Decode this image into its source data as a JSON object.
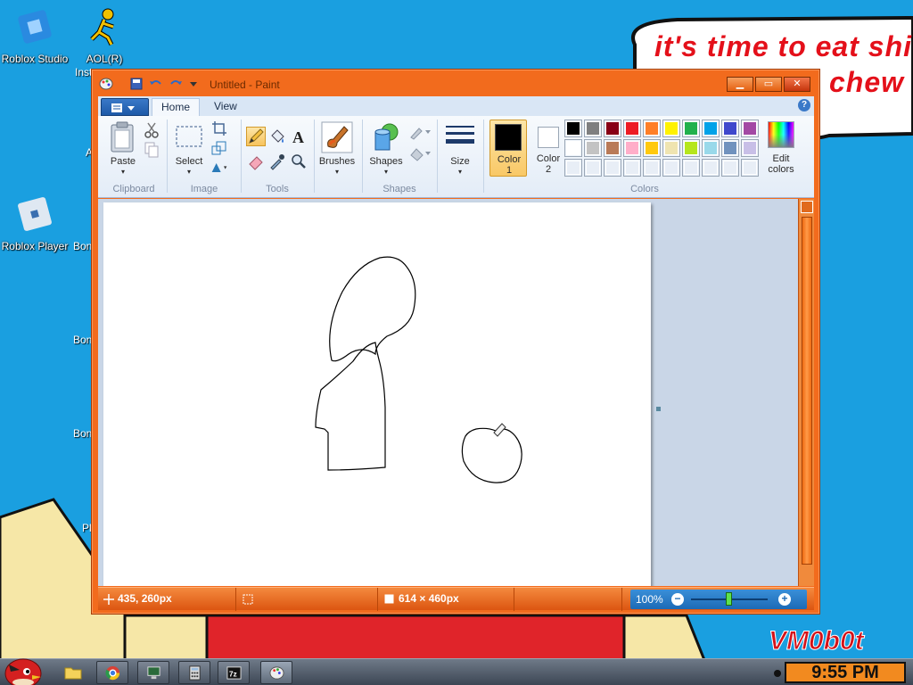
{
  "desktop": {
    "icons": [
      {
        "label": "Roblox Studio"
      },
      {
        "label": "AOL(R)"
      },
      {
        "label": "Inst"
      },
      {
        "label": "Roblox Player"
      }
    ],
    "cut_labels": [
      "A",
      "Bon",
      "Bon",
      "Bon",
      "Pl"
    ],
    "speech_line1": "it's time to eat shit",
    "speech_line2": "chew",
    "watermark": "VM0b0t"
  },
  "window": {
    "title": "Untitled - Paint",
    "buttons": {
      "minimize": "▁",
      "maximize": "▭",
      "close": "✕"
    }
  },
  "ribbon": {
    "tabs": [
      {
        "label": "Home"
      },
      {
        "label": "View"
      }
    ],
    "help": "?",
    "groups": {
      "clipboard": "Clipboard",
      "image": "Image",
      "tools": "Tools",
      "shapes": "Shapes",
      "colors": "Colors"
    },
    "buttons": {
      "paste": "Paste",
      "select": "Select",
      "brushes": "Brushes",
      "shapes": "Shapes",
      "size": "Size",
      "color1_line1": "Color",
      "color1_line2": "1",
      "color2_line1": "Color",
      "color2_line2": "2",
      "edit_colors_line1": "Edit",
      "edit_colors_line2": "colors"
    },
    "color1": "#000000",
    "color2": "#ffffff",
    "palette_row1": [
      "#000000",
      "#7f7f7f",
      "#880015",
      "#ed1c24",
      "#ff7f27",
      "#fff200",
      "#22b14c",
      "#00a2e8",
      "#3f48cc",
      "#a349a4"
    ],
    "palette_row2": [
      "#ffffff",
      "#c3c3c3",
      "#b97a57",
      "#ffaec9",
      "#ffc90e",
      "#efe4b0",
      "#b5e61d",
      "#99d9ea",
      "#7092be",
      "#c8bfe7"
    ],
    "palette_row3": [
      "#e8eef6",
      "#e8eef6",
      "#e8eef6",
      "#e8eef6",
      "#e8eef6",
      "#e8eef6",
      "#e8eef6",
      "#e8eef6",
      "#e8eef6",
      "#e8eef6"
    ]
  },
  "status": {
    "cursor_pos": "435, 260px",
    "selection": "",
    "canvas_size": "614 × 460px",
    "zoom": "100%",
    "zoom_level": 0.5
  },
  "taskbar": {
    "clock": "9:55 PM"
  },
  "colors": {
    "desktop_bg": "#1a9fe0",
    "window_frame": "#f26b1d",
    "speech_text": "#e4101a"
  }
}
